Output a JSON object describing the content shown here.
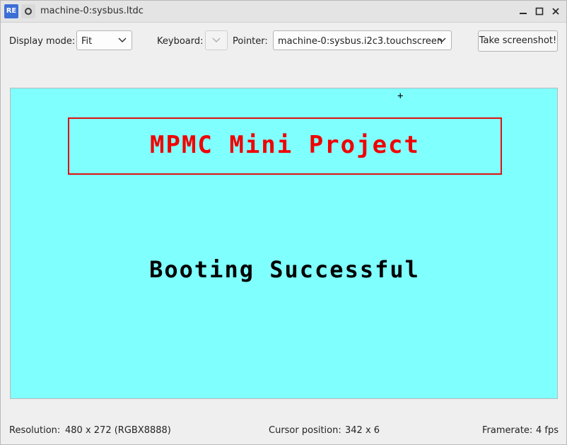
{
  "window": {
    "app_icon_text": "RE",
    "title": "machine-0:sysbus.ltdc",
    "controls": {
      "minimize": "minimize-icon",
      "maximize": "maximize-icon",
      "close": "close-icon"
    }
  },
  "toolbar": {
    "display_mode_label": "Display mode:",
    "display_mode_value": "Fit",
    "keyboard_label": "Keyboard:",
    "keyboard_value": "",
    "pointer_label": "Pointer:",
    "pointer_value": "machine-0:sysbus.i2c3.touchscreen",
    "screenshot_label": "Take screenshot!"
  },
  "display": {
    "background_color": "#80ffff",
    "cursor_marker": "+",
    "title_text": "MPMC Mini Project",
    "title_color": "#f00000",
    "message_text": "Booting Successful",
    "message_color": "#000000"
  },
  "status": {
    "resolution_label": "Resolution:",
    "resolution_value": "480 x 272 (RGBX8888)",
    "cursor_label": "Cursor position:",
    "cursor_value": "342 x 6",
    "framerate_label": "Framerate:",
    "framerate_value": "4 fps"
  }
}
